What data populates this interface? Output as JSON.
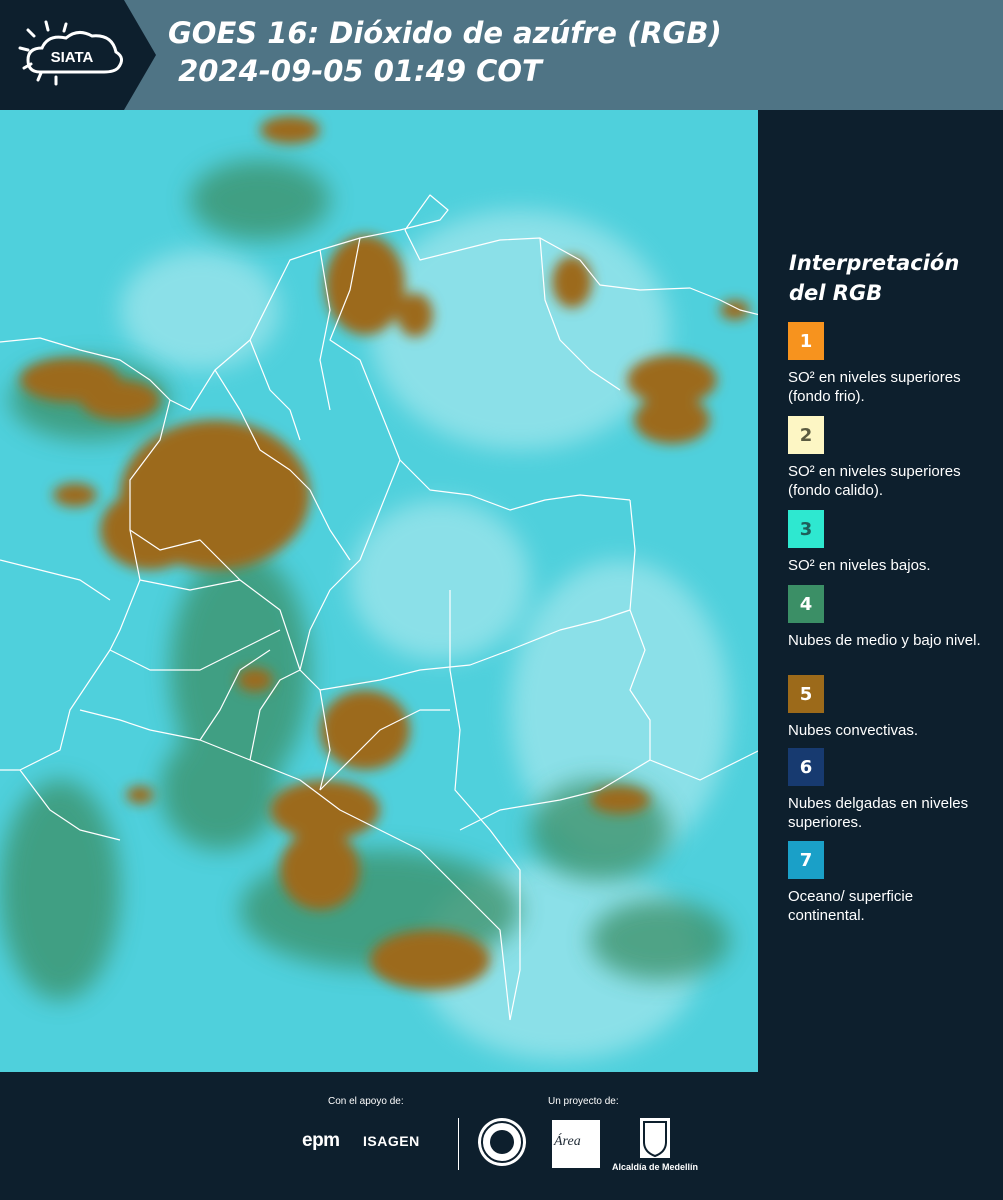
{
  "header": {
    "logo_text": "SIATA",
    "title_line1": "GOES 16: Dióxido de azúfre (RGB)",
    "title_line2": " 2024-09-05 01:49 COT"
  },
  "legend": {
    "title": "Interpretación del RGB",
    "items": [
      {
        "number": "1",
        "color": "#f7931e",
        "num_color": "#ffffff",
        "text": "SO² en niveles superiores (fondo frio)."
      },
      {
        "number": "2",
        "color": "#fdf6c4",
        "num_color": "#5a5a40",
        "text": "SO² en niveles superiores (fondo calido)."
      },
      {
        "number": "3",
        "color": "#2ee8d0",
        "num_color": "#1e5f5a",
        "text": "SO² en niveles bajos."
      },
      {
        "number": "4",
        "color": "#3b8f66",
        "num_color": "#ffffff",
        "text": "Nubes de medio y bajo nivel."
      },
      {
        "number": "5",
        "color": "#9c6a1a",
        "num_color": "#ffffff",
        "text": "Nubes convectivas."
      },
      {
        "number": "6",
        "color": "#173a70",
        "num_color": "#ffffff",
        "text": "Nubes delgadas en niveles superiores."
      },
      {
        "number": "7",
        "color": "#1aa0c8",
        "num_color": "#ffffff",
        "text": "Oceano/ superficie continental."
      }
    ]
  },
  "footer": {
    "support_label": "Con el apoyo de:",
    "project_label": "Un proyecto de:",
    "epm": "epm",
    "isagen": "ISAGEN",
    "area_logo": "Área",
    "alcaldia": "Alcaldía de Medellín"
  },
  "colors": {
    "header_bg": "#4f7485",
    "panel_bg": "#0d1f2d",
    "ocean": "#4fd0dc",
    "convective": "#9c6a1a",
    "mid_low": "#3b8f66",
    "borders": "#ffffff"
  }
}
